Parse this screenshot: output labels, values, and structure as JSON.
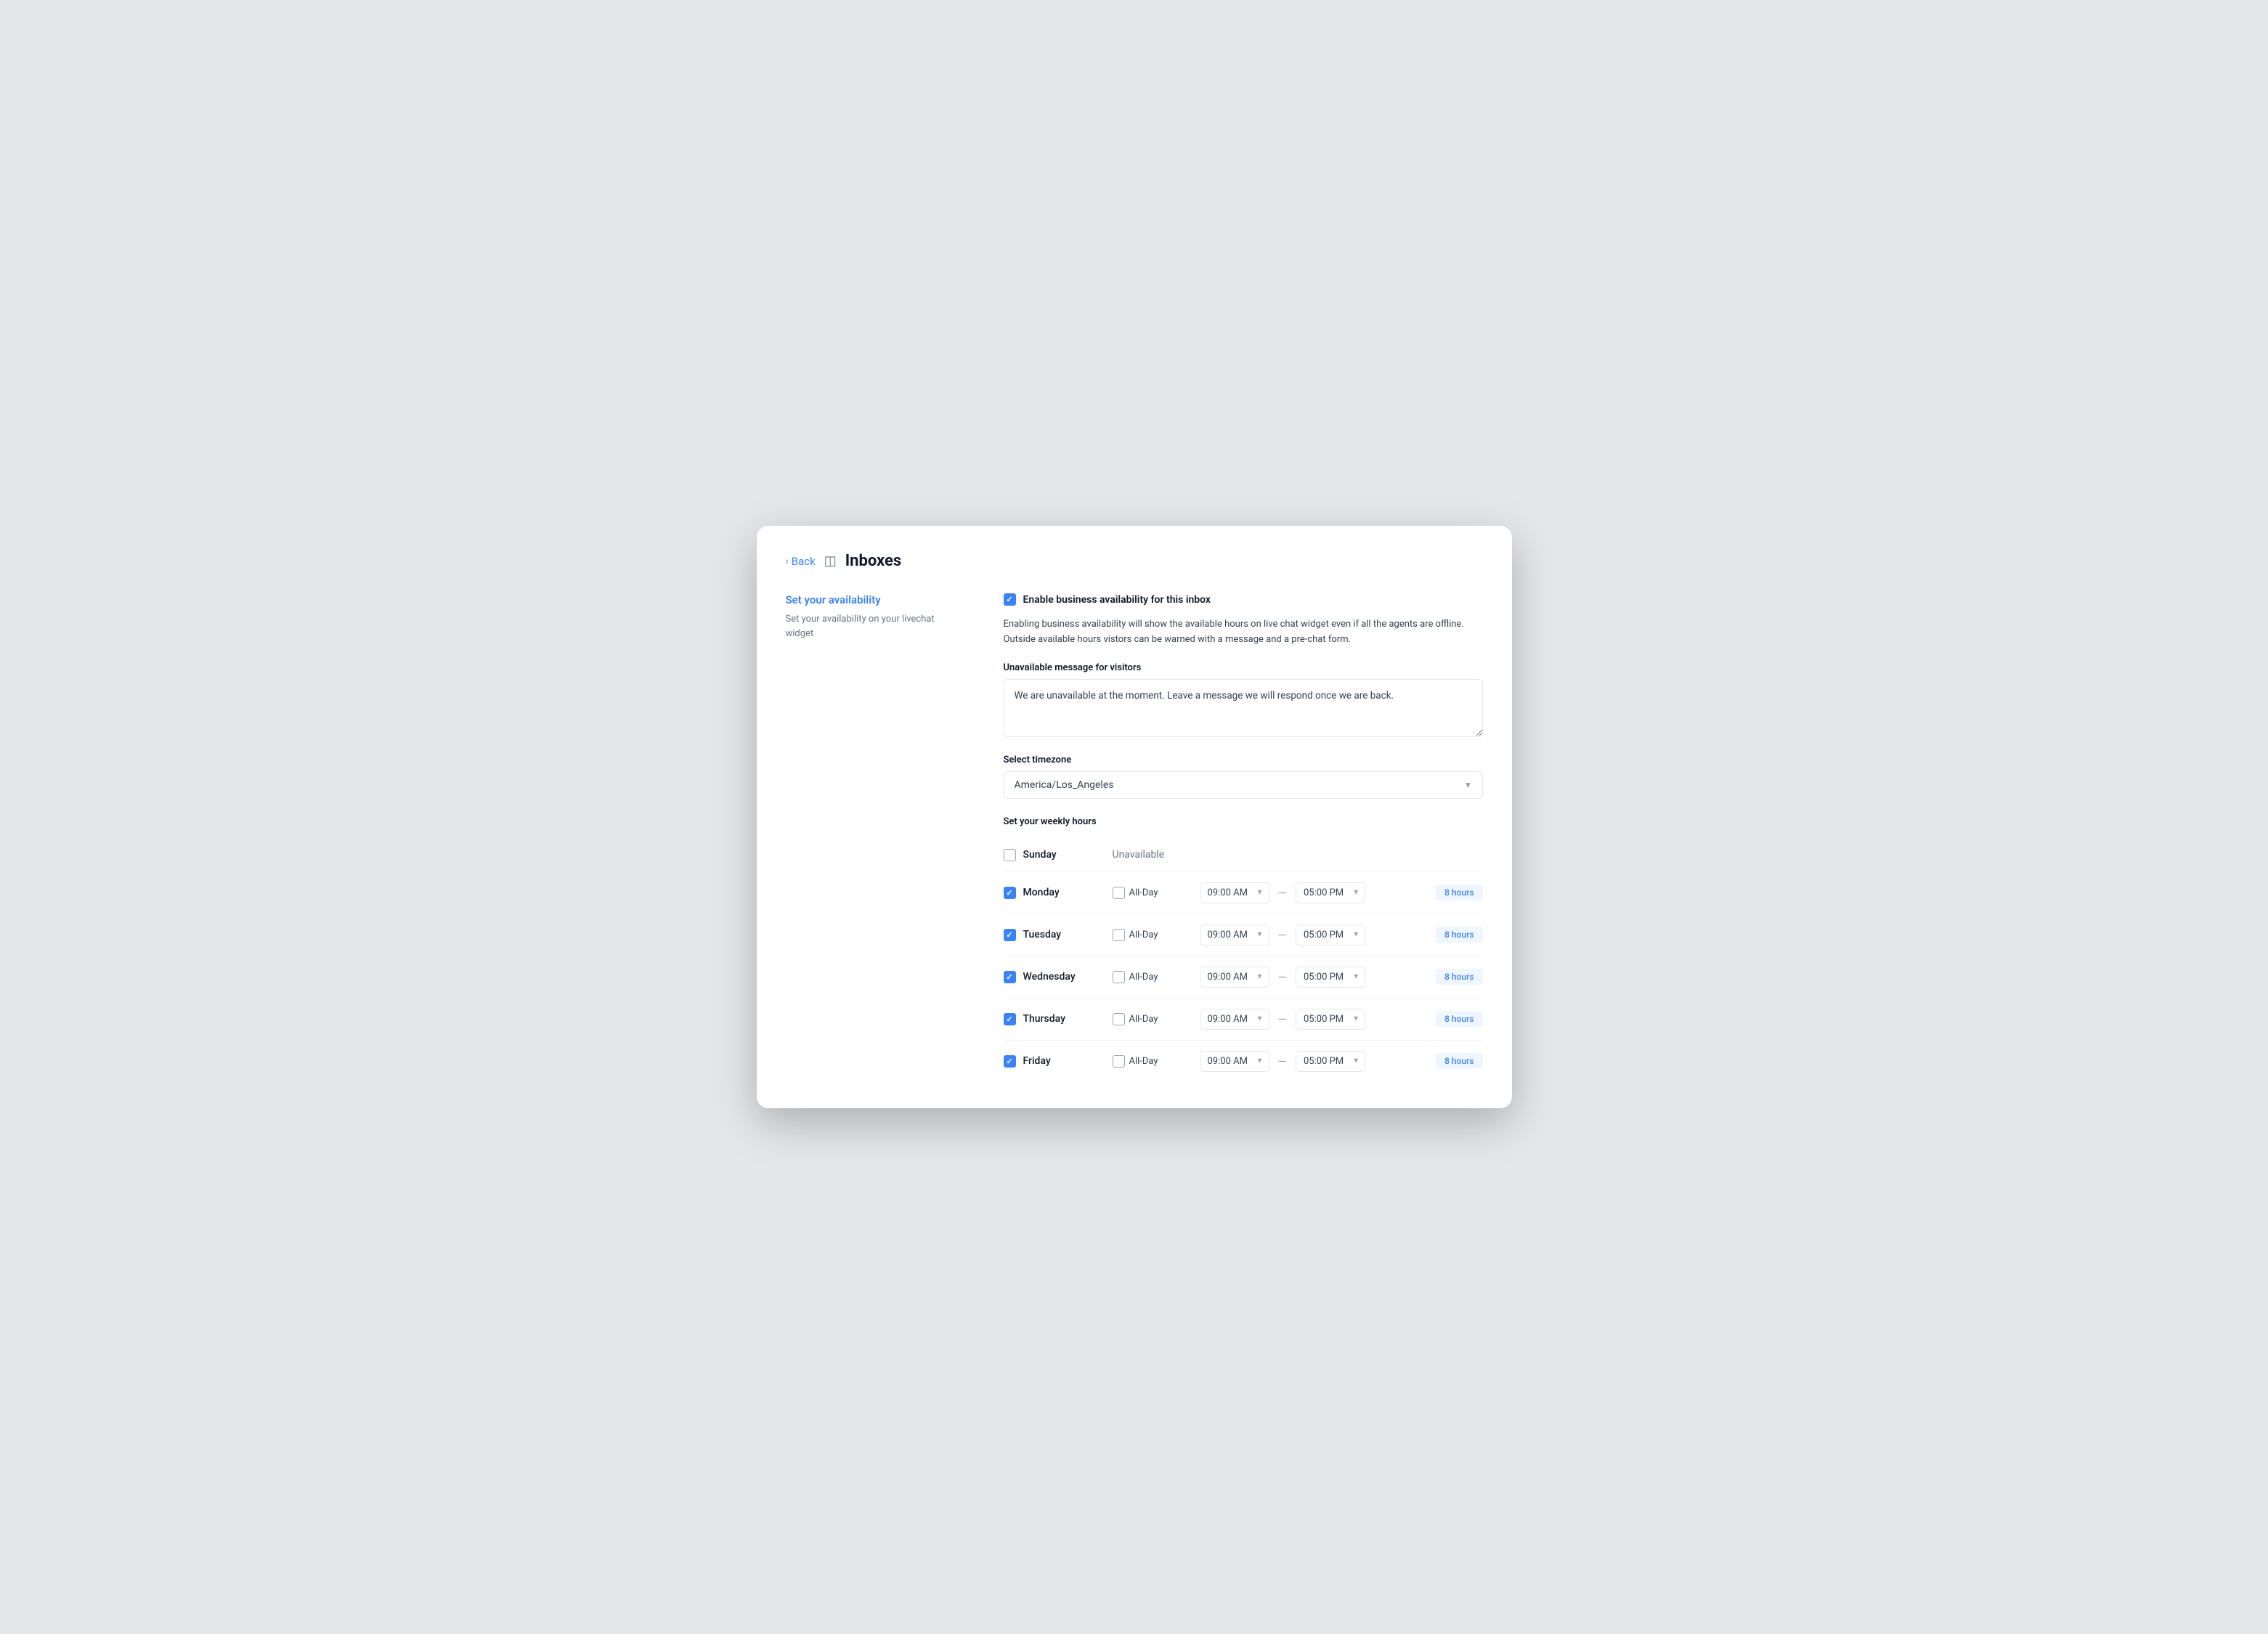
{
  "header": {
    "back_label": "Back",
    "page_title": "Inboxes"
  },
  "left_panel": {
    "section_title": "Set your availability",
    "section_subtitle": "Set your availability on your livechat widget"
  },
  "right_panel": {
    "enable_checkbox": true,
    "enable_label": "Enable business availability for this inbox",
    "description": "Enabling business availability will show the available hours on live chat widget even if all the agents are offline. Outside available hours vistors can be warned with a message and a pre-chat form.",
    "unavailable_message_label": "Unavailable message for visitors",
    "unavailable_message_value": "We are unavailable at the moment. Leave a message we will respond once we are back.",
    "timezone_label": "Select timezone",
    "timezone_value": "America/Los_Angeles",
    "weekly_hours_label": "Set your weekly hours",
    "days": [
      {
        "name": "Sunday",
        "enabled": false,
        "show_unavailable": true,
        "all_day": false,
        "start_time": "",
        "end_time": "",
        "hours": ""
      },
      {
        "name": "Monday",
        "enabled": true,
        "show_unavailable": false,
        "all_day": false,
        "start_time": "09:00 AM",
        "end_time": "05:00 PM",
        "hours": "8 hours"
      },
      {
        "name": "Tuesday",
        "enabled": true,
        "show_unavailable": false,
        "all_day": false,
        "start_time": "09:00 AM",
        "end_time": "05:00 PM",
        "hours": "8 hours"
      },
      {
        "name": "Wednesday",
        "enabled": true,
        "show_unavailable": false,
        "all_day": false,
        "start_time": "09:00 AM",
        "end_time": "05:00 PM",
        "hours": "8 hours"
      },
      {
        "name": "Thursday",
        "enabled": true,
        "show_unavailable": false,
        "all_day": false,
        "start_time": "09:00 AM",
        "end_time": "05:00 PM",
        "hours": "8 hours"
      },
      {
        "name": "Friday",
        "enabled": true,
        "show_unavailable": false,
        "all_day": false,
        "start_time": "09:00 AM",
        "end_time": "05:00 PM",
        "hours": "8 hours"
      }
    ],
    "unavailable_label": "Unavailable",
    "all_day_label": "All-Day"
  }
}
